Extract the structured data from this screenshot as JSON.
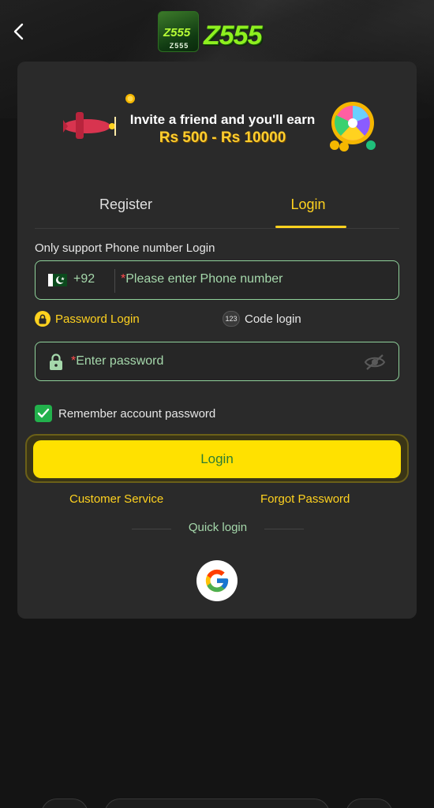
{
  "header": {
    "logo_small_text": "Z555",
    "logo_small_mark": "Z555",
    "logo_main_text": "Z555"
  },
  "banner": {
    "line1": "Invite a friend and you'll earn",
    "line2": "Rs 500 - Rs 10000"
  },
  "tabs": [
    {
      "label": "Register",
      "active": false
    },
    {
      "label": "Login",
      "active": true
    }
  ],
  "login": {
    "helper_text": "Only support Phone number Login",
    "country_code": "+92",
    "phone_required_mark": "*",
    "phone_placeholder": "Please enter Phone number",
    "mode_password_label": "Password Login",
    "mode_code_badge": "123",
    "mode_code_label": "Code login",
    "password_required_mark": "*",
    "password_placeholder": "Enter password",
    "remember_label": "Remember account password",
    "remember_checked": true,
    "submit_label": "Login",
    "customer_service_label": "Customer Service",
    "forgot_password_label": "Forgot Password",
    "quick_login_label": "Quick login"
  },
  "colors": {
    "accent": "#ffd21f",
    "button_bg": "#ffe100",
    "button_text": "#2e7d32",
    "field_border": "#8fd19a",
    "placeholder": "#a5d8ab",
    "checkbox": "#22b14c",
    "card_bg": "#2a2a2a",
    "page_bg": "#141414"
  },
  "icons": {
    "back": "chevron-left-icon",
    "lock": "lock-icon",
    "eye_off": "eye-off-icon",
    "check": "check-icon",
    "google": "google-icon",
    "flag": "pakistan-flag-icon"
  }
}
